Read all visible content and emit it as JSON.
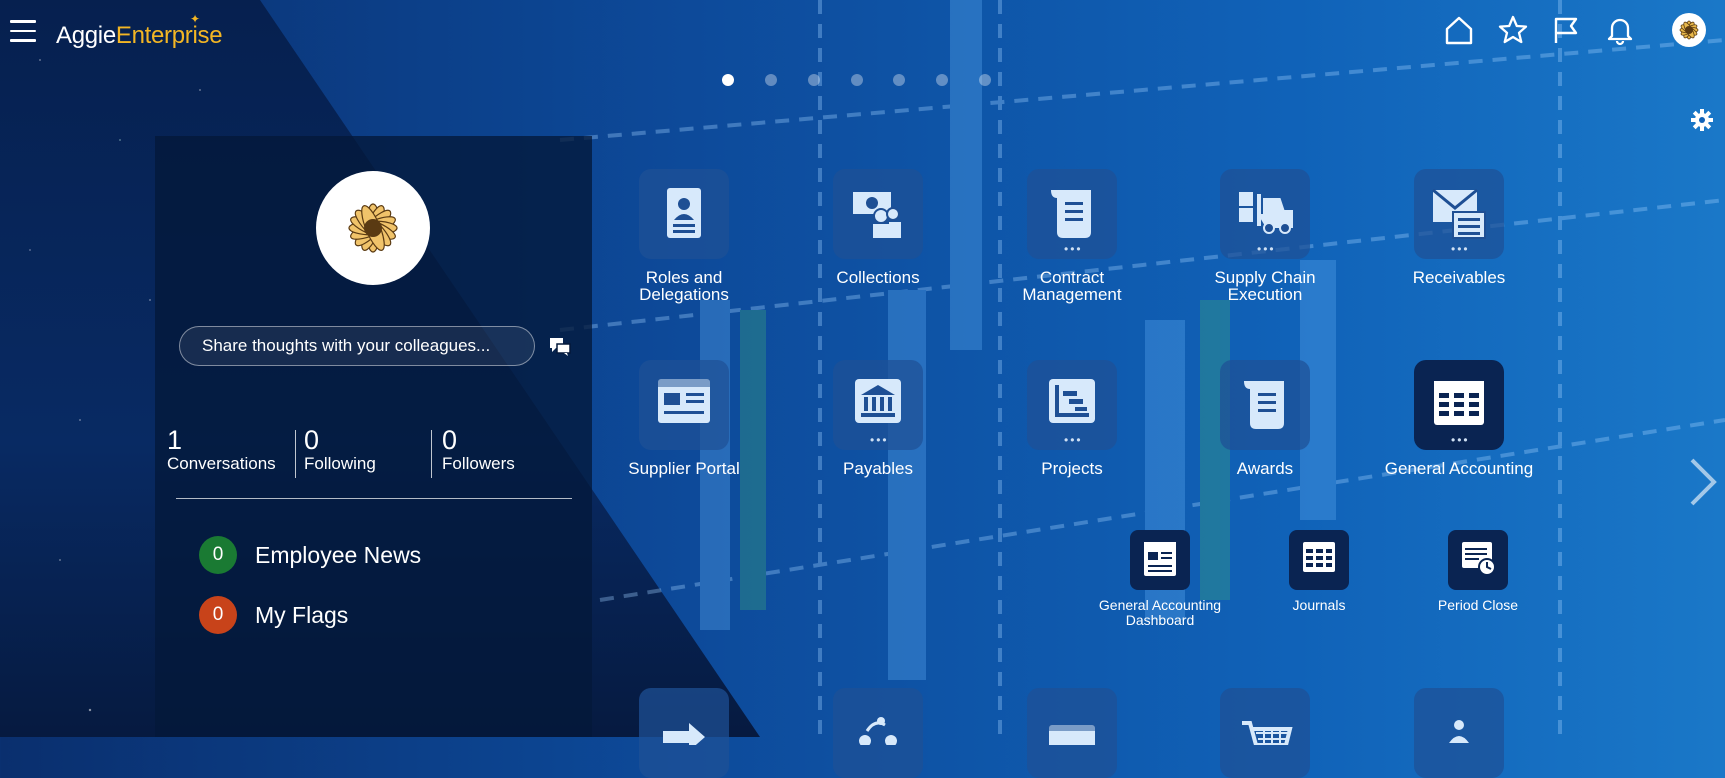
{
  "header": {
    "logo_part1": "Aggie",
    "logo_part2": "Enterprise",
    "icons": [
      "home-icon",
      "favorites-star-icon",
      "flag-icon",
      "notifications-bell-icon",
      "user-avatar"
    ]
  },
  "pager": {
    "count": 7,
    "active_index": 0
  },
  "profile": {
    "share_placeholder": "Share thoughts with your colleagues...",
    "stats": [
      {
        "value": "1",
        "label": "Conversations"
      },
      {
        "value": "0",
        "label": "Following"
      },
      {
        "value": "0",
        "label": "Followers"
      }
    ],
    "news": [
      {
        "count": "0",
        "label": "Employee News",
        "color": "#1a7a33"
      },
      {
        "count": "0",
        "label": "My Flags",
        "color": "#c8431a"
      }
    ]
  },
  "apps": {
    "row1": [
      {
        "label_line1": "Roles and",
        "label_line2": "Delegations",
        "icon": "id-badge-icon",
        "has_more": false
      },
      {
        "label_line1": "Collections",
        "label_line2": "",
        "icon": "money-people-icon",
        "has_more": false
      },
      {
        "label_line1": "Contract",
        "label_line2": "Management",
        "icon": "scroll-document-icon",
        "has_more": true
      },
      {
        "label_line1": "Supply Chain",
        "label_line2": "Execution",
        "icon": "forklift-icon",
        "has_more": true
      },
      {
        "label_line1": "Receivables",
        "label_line2": "",
        "icon": "envelope-invoice-icon",
        "has_more": true
      }
    ],
    "row2": [
      {
        "label": "Supplier Portal",
        "icon": "portal-dashboard-icon",
        "has_more": false
      },
      {
        "label": "Payables",
        "icon": "bank-icon",
        "has_more": true
      },
      {
        "label": "Projects",
        "icon": "chart-steps-icon",
        "has_more": true
      },
      {
        "label": "Awards",
        "icon": "scroll-icon",
        "has_more": false
      },
      {
        "label": "General Accounting",
        "icon": "ledger-grid-icon",
        "has_more": true
      }
    ],
    "general_accounting_children": [
      {
        "label_line1": "General Accounting",
        "label_line2": "Dashboard",
        "icon": "dashboard-icon"
      },
      {
        "label_line1": "Journals",
        "label_line2": "",
        "icon": "journal-grid-icon"
      },
      {
        "label_line1": "Period Close",
        "label_line2": "",
        "icon": "period-close-clock-icon"
      }
    ]
  }
}
